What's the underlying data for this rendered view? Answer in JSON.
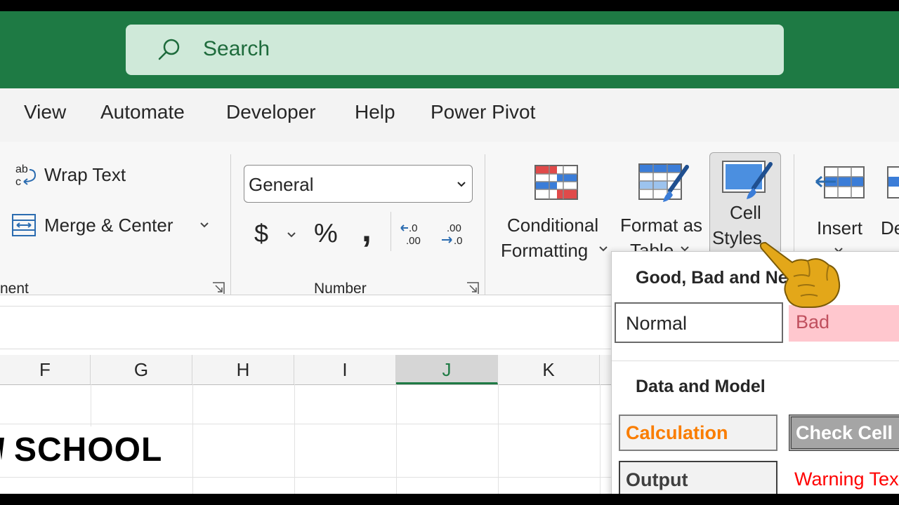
{
  "search": {
    "placeholder": "Search"
  },
  "tabs": [
    {
      "label": "View"
    },
    {
      "label": "Automate"
    },
    {
      "label": "Developer"
    },
    {
      "label": "Help"
    },
    {
      "label": "Power Pivot"
    }
  ],
  "alignment": {
    "wrap_text": "Wrap Text",
    "wrap_icon": "ab c",
    "merge_center": "Merge & Center",
    "group_label": "nent"
  },
  "number": {
    "format_value": "General",
    "currency": "$",
    "percent": "%",
    "comma": ",",
    "group_label": "Number"
  },
  "styles": {
    "conditional_formatting_l1": "Conditional",
    "conditional_formatting_l2": "Formatting",
    "format_table_l1": "Format as",
    "format_table_l2": "Table",
    "cell_styles_l1": "Cell",
    "cell_styles_l2": "Styles"
  },
  "cells_group": {
    "insert": "Insert",
    "delete_partial": "De"
  },
  "columns": [
    "F",
    "G",
    "H",
    "I",
    "J",
    "K"
  ],
  "sheet": {
    "title_text": "SCHOOL"
  },
  "cell_styles_menu": {
    "section1": "Good, Bad and Neutral",
    "normal": "Normal",
    "bad": "Bad",
    "section2": "Data and Model",
    "calculation": "Calculation",
    "check_cell": "Check Cell",
    "output": "Output",
    "warning_text": "Warning Text"
  },
  "colors": {
    "brand_green": "#1e7a44",
    "bad_bg": "#ffc7ce",
    "bad_fg": "#9c0006",
    "calc_fg": "#fa7d00",
    "warning_fg": "#ff0000"
  }
}
